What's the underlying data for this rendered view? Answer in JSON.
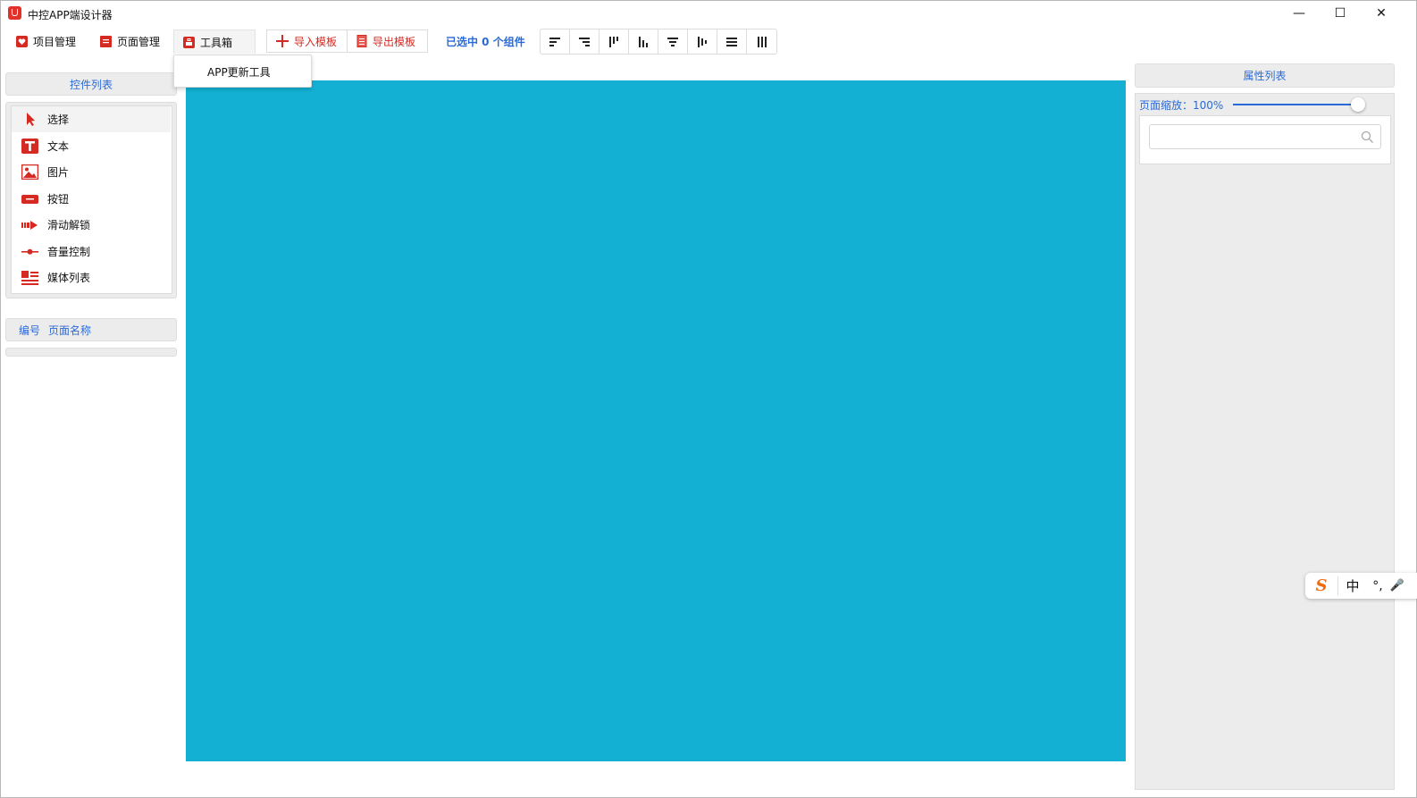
{
  "window": {
    "title": "中控APP端设计器",
    "minimize_glyph": "—",
    "maximize_glyph": "☐",
    "close_glyph": "✕"
  },
  "menu": {
    "project": "项目管理",
    "page": "页面管理",
    "toolbox": "工具箱"
  },
  "toolbox_dropdown": {
    "items": [
      "APP更新工具"
    ]
  },
  "toolbar": {
    "import_template": "导入模板",
    "export_template": "导出模板",
    "selection_status": "已选中 0 个组件",
    "align_buttons": [
      "align-left-icon",
      "align-right-icon",
      "align-top-icon",
      "align-bottom-icon",
      "align-center-horizontal-icon",
      "align-center-vertical-icon",
      "distribute-horizontal-icon",
      "distribute-vertical-icon"
    ]
  },
  "left_panel": {
    "controls_header": "控件列表",
    "controls": [
      {
        "label": "选择",
        "icon": "cursor-icon"
      },
      {
        "label": "文本",
        "icon": "text-icon"
      },
      {
        "label": "图片",
        "icon": "image-icon"
      },
      {
        "label": "按钮",
        "icon": "button-icon"
      },
      {
        "label": "滑动解锁",
        "icon": "slide-unlock-icon"
      },
      {
        "label": "音量控制",
        "icon": "volume-slider-icon"
      },
      {
        "label": "媒体列表",
        "icon": "media-list-icon"
      }
    ],
    "page_list_header": {
      "col_id": "编号",
      "col_name": "页面名称"
    }
  },
  "canvas": {
    "background": "#13b0d3"
  },
  "right_panel": {
    "header": "属性列表",
    "zoom_label": "页面缩放：100%",
    "zoom_value": 1.0,
    "search_placeholder": "",
    "search_value": ""
  },
  "ime": {
    "logo": "S",
    "mode": "中",
    "punct": "°,",
    "voice": "🎤"
  },
  "colors": {
    "accent": "#2a6ad8",
    "brand_red": "#d42a22",
    "canvas": "#13b0d3"
  }
}
